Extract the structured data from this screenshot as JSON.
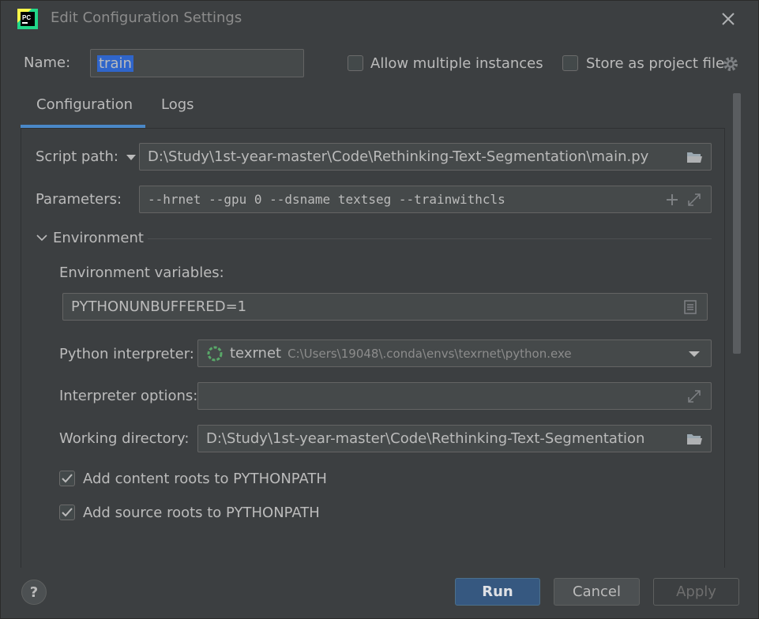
{
  "window": {
    "title": "Edit Configuration Settings",
    "logo_text": "PC"
  },
  "name_row": {
    "label": "Name:",
    "value": "train",
    "allow_multiple_label": "Allow multiple instances",
    "allow_multiple_checked": false,
    "store_as_project_label": "Store as project file",
    "store_as_project_checked": false
  },
  "tabs": [
    {
      "label": "Configuration",
      "active": true
    },
    {
      "label": "Logs",
      "active": false
    }
  ],
  "form": {
    "script_path_label": "Script path:",
    "script_path_value": "D:\\Study\\1st-year-master\\Code\\Rethinking-Text-Segmentation\\main.py",
    "parameters_label": "Parameters:",
    "parameters_value": "--hrnet --gpu 0 --dsname textseg --trainwithcls",
    "environment_section": "Environment",
    "env_vars_label": "Environment variables:",
    "env_vars_value": "PYTHONUNBUFFERED=1",
    "interpreter_label": "Python interpreter:",
    "interpreter_name": "texrnet",
    "interpreter_path": "C:\\Users\\19048\\.conda\\envs\\texrnet\\python.exe",
    "interpreter_options_label": "Interpreter options:",
    "interpreter_options_value": "",
    "working_dir_label": "Working directory:",
    "working_dir_value": "D:\\Study\\1st-year-master\\Code\\Rethinking-Text-Segmentation",
    "content_roots_label": "Add content roots to PYTHONPATH",
    "content_roots_checked": true,
    "source_roots_label": "Add source roots to PYTHONPATH",
    "source_roots_checked": true
  },
  "buttons": {
    "help": "?",
    "run": "Run",
    "cancel": "Cancel",
    "apply": "Apply"
  },
  "colors": {
    "background": "#3c3f41",
    "accent": "#4a88c7",
    "primary_button": "#365880",
    "interpreter_ring": "#59a869"
  }
}
